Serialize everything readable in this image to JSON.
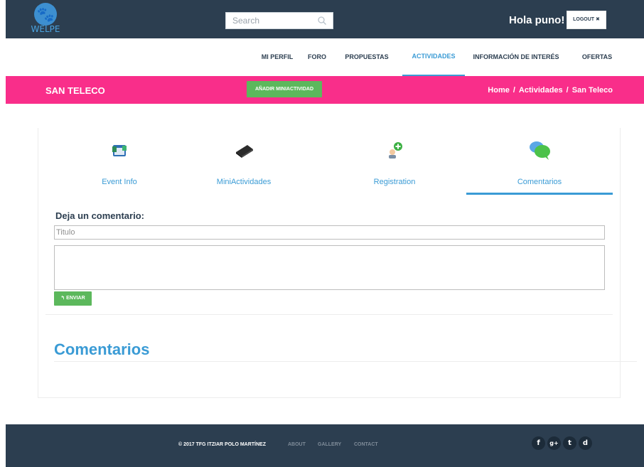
{
  "header": {
    "logo_text": "WELPE",
    "search_placeholder": "Search",
    "greeting": "Hola puno!",
    "logout_label": "LOGOUT ✖"
  },
  "nav": {
    "items": [
      {
        "label": "MI PERFIL"
      },
      {
        "label": "FORO"
      },
      {
        "label": "PROPUESTAS"
      },
      {
        "label": "ACTIVIDADES"
      },
      {
        "label": "INFORMACIÓN DE INTERÉS"
      },
      {
        "label": "OFERTAS"
      }
    ],
    "active": "ACTIVIDADES"
  },
  "band": {
    "title": "SAN TELECO",
    "add_button": "AÑADIR MINIACTIVIDAD",
    "breadcrumb": [
      "Home",
      "Actividades",
      "San Teleco"
    ]
  },
  "tabs": [
    {
      "label": "Event Info",
      "icon": "event-info-icon"
    },
    {
      "label": "MiniActividades",
      "icon": "mini-activities-icon"
    },
    {
      "label": "Registration",
      "icon": "registration-icon"
    },
    {
      "label": "Comentarios",
      "icon": "comments-icon"
    }
  ],
  "form": {
    "title": "Deja un comentario:",
    "title_placeholder": "Titulo",
    "submit_label": "↰ ENVIAR"
  },
  "comments": {
    "heading": "Comentarios"
  },
  "footer": {
    "copyright": "© 2017 TFG ITZIAR POLO MARTÍNEZ",
    "links": [
      "ABOUT",
      "GALLERY",
      "CONTACT"
    ],
    "social": [
      "f",
      "g+",
      "t",
      "d"
    ]
  },
  "colors": {
    "header_bg": "#2c3e50",
    "accent_pink": "#f92e8a",
    "accent_blue": "#3a9bd5",
    "button_green": "#5cb85c"
  }
}
